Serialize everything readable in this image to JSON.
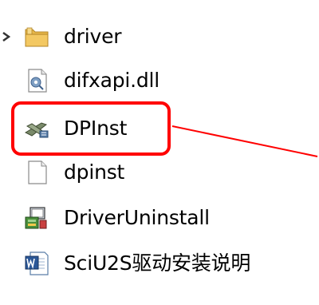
{
  "items": [
    {
      "label": "driver",
      "icon": "folder-icon"
    },
    {
      "label": "difxapi.dll",
      "icon": "dll-file-icon"
    },
    {
      "label": "DPInst",
      "icon": "dpinst-app-icon"
    },
    {
      "label": "dpinst",
      "icon": "blank-file-icon"
    },
    {
      "label": "DriverUninstall",
      "icon": "installer-app-icon"
    },
    {
      "label": "SciU2S驱动安装说明",
      "icon": "word-document-icon"
    }
  ],
  "colors": {
    "highlight": "#ff0000",
    "folder": "#e8b84a",
    "word_blue": "#2b5797"
  }
}
